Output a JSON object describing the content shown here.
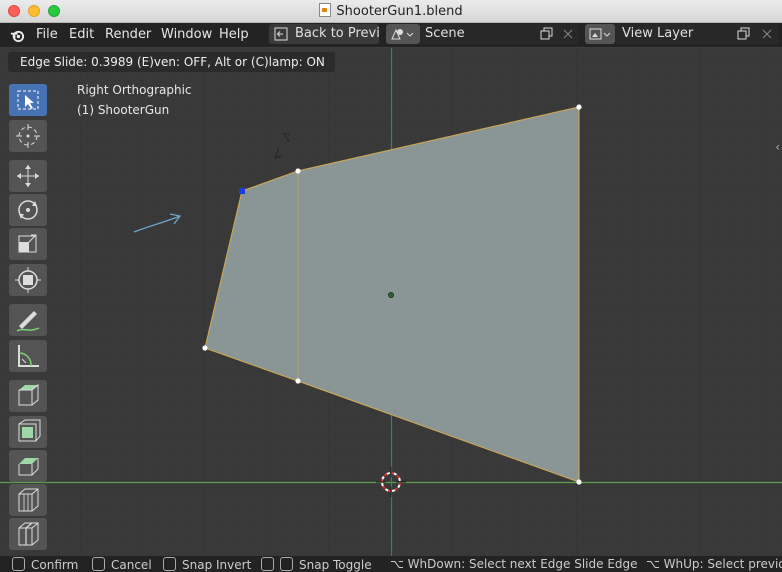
{
  "window": {
    "title": "ShooterGun1.blend"
  },
  "menu": [
    "File",
    "Edit",
    "Render",
    "Window",
    "Help"
  ],
  "header": {
    "back_label": "Back to Previous",
    "scene_label": "Scene",
    "view_layer_label": "View Layer"
  },
  "hint": {
    "text": "Edge Slide: 0.3989 (E)ven: OFF, Alt or (C)lamp: ON"
  },
  "viewport": {
    "view_name": "Right Orthographic",
    "object_name": "(1) ShooterGun",
    "mesh_fill": "#8a9596",
    "edge_color": "#c8a45a",
    "axis_green": "#5d9e4a",
    "axis_blue": "#2f7f8a"
  },
  "tools": [
    "select-box-icon",
    "cursor-icon",
    "move-icon",
    "rotate-icon",
    "scale-icon",
    "transform-icon",
    "annotate-icon",
    "measure-icon",
    "add-cube-icon",
    "extrude-icon",
    "inset-icon",
    "bevel-icon",
    "loop-cut-icon"
  ],
  "statusbar": {
    "confirm": "Confirm",
    "cancel": "Cancel",
    "snap_invert": "Snap Invert",
    "snap_toggle": "Snap Toggle",
    "wheel_down": "⌥ WhDown: Select next Edge Slide Edge",
    "wheel_up": "⌥ WhUp: Select previous"
  }
}
